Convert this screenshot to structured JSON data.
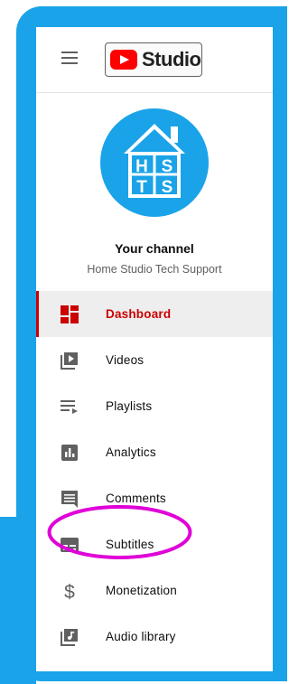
{
  "header": {
    "menu_icon": "hamburger-icon",
    "logo_text": "Studio"
  },
  "channel": {
    "avatar_icon": "house-logo-icon",
    "avatar_letters": [
      "H",
      "S",
      "T",
      "S"
    ],
    "title": "Your channel",
    "name": "Home Studio Tech Support"
  },
  "nav": {
    "items": [
      {
        "label": "Dashboard",
        "icon": "dashboard-icon",
        "active": true
      },
      {
        "label": "Videos",
        "icon": "video-icon",
        "active": false
      },
      {
        "label": "Playlists",
        "icon": "playlist-icon",
        "active": false
      },
      {
        "label": "Analytics",
        "icon": "analytics-icon",
        "active": false
      },
      {
        "label": "Comments",
        "icon": "comment-icon",
        "active": false
      },
      {
        "label": "Subtitles",
        "icon": "subtitles-icon",
        "active": false
      },
      {
        "label": "Monetization",
        "icon": "dollar-icon",
        "active": false
      },
      {
        "label": "Audio library",
        "icon": "audio-library-icon",
        "active": false
      }
    ]
  },
  "colors": {
    "frame": "#1aa3e8",
    "accent": "#cc0000",
    "highlight": "#e000d8"
  }
}
